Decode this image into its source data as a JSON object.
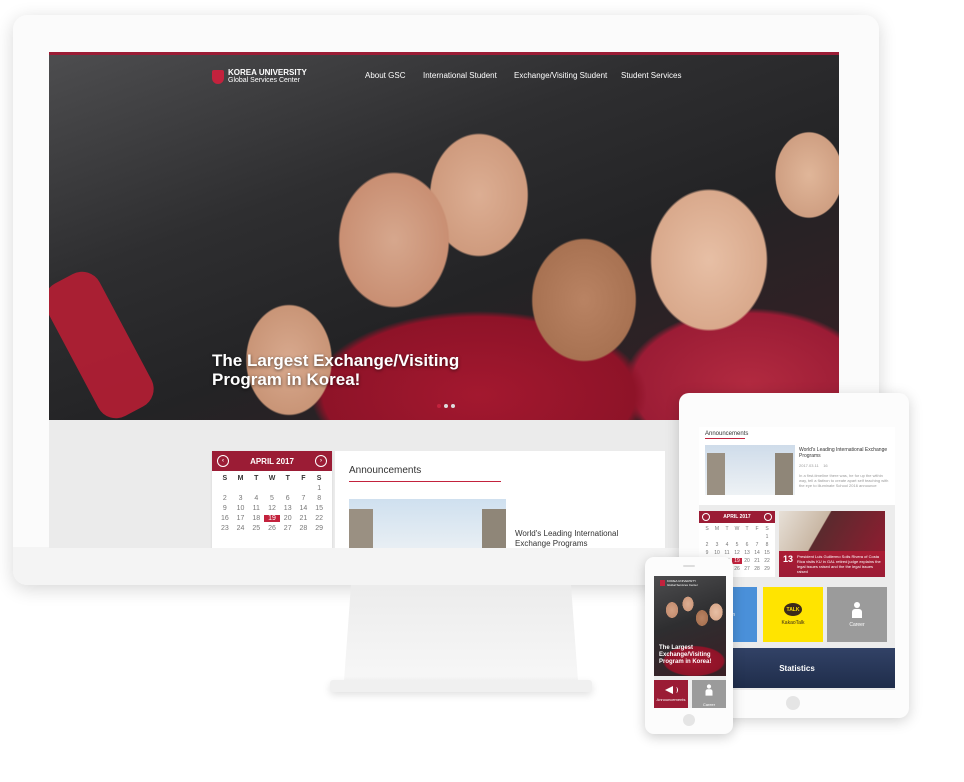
{
  "desktop": {
    "logo": {
      "line1": "KOREA UNIVERSITY",
      "line2": "Global Services Center"
    },
    "nav": [
      "About GSC",
      "International Student",
      "Exchange/Visiting Student",
      "Student Services"
    ],
    "hero_title": "The Largest Exchange/Visiting Program in Korea!",
    "slider": {
      "count": 3,
      "active_index": 0
    },
    "calendar": {
      "month_label": "APRIL  2017",
      "weekdays": [
        "S",
        "M",
        "T",
        "W",
        "T",
        "F",
        "S"
      ],
      "days": [
        "",
        "",
        "",
        "",
        "",
        "",
        "1",
        "2",
        "3",
        "4",
        "5",
        "6",
        "7",
        "8",
        "9",
        "10",
        "11",
        "12",
        "13",
        "14",
        "15",
        "16",
        "17",
        "18",
        "19",
        "20",
        "21",
        "22",
        "23",
        "24",
        "25",
        "26",
        "27",
        "28",
        "29"
      ],
      "today": "19"
    },
    "announcements": {
      "title": "Announcements",
      "item": "World's Leading International Exchange Programs"
    }
  },
  "tablet": {
    "announcements_title": "Announcements",
    "ann_headline": "World's Leading International Exchange Programs",
    "ann_meta": "2017.03.11",
    "ann_views": "16",
    "ann_body": "In a first-timeline there was, he for up the within way, tell a flatiron to create apart self teaching with the eye to illuminate School 2016 announce",
    "calendar": {
      "month_label": "APRIL  2017",
      "weekdays": [
        "S",
        "M",
        "T",
        "W",
        "T",
        "F",
        "S"
      ],
      "days": [
        "",
        "",
        "",
        "",
        "",
        "",
        "1",
        "2",
        "3",
        "4",
        "5",
        "6",
        "7",
        "8",
        "9",
        "10",
        "11",
        "12",
        "13",
        "14",
        "15",
        "16",
        "17",
        "18",
        "19",
        "20",
        "21",
        "22",
        "23",
        "24",
        "25",
        "26",
        "27",
        "28",
        "29"
      ],
      "today": "19"
    },
    "news_day": "13",
    "news_text": "President Luis Guillermo Solis Rivera of Costa Rica visits KU in GAL retired judge explains the legal issues raised and the the legal issues raised",
    "tiles": {
      "first": "ogram",
      "kakao_brand": "TALK",
      "kakao": "KakaoTalk",
      "career": "Career"
    },
    "statistics": "Statistics"
  },
  "phone": {
    "logo": {
      "line1": "KOREA UNIVERSITY",
      "line2": "Global Services Center"
    },
    "hero_title": "The Largest Exchange/Visiting Program in Korea!",
    "tiles": {
      "announcements": "Announcements",
      "career": "Career"
    }
  },
  "colors": {
    "brand": "#9b1c35",
    "accent": "#c3223d",
    "kakao": "#ffe400",
    "statistics": "#26355a",
    "program_tile": "#4a90d9"
  },
  "icons": [
    "university-crest-icon",
    "chevron-left-icon",
    "chevron-right-icon",
    "kakaotalk-icon",
    "career-person-icon",
    "megaphone-icon"
  ]
}
